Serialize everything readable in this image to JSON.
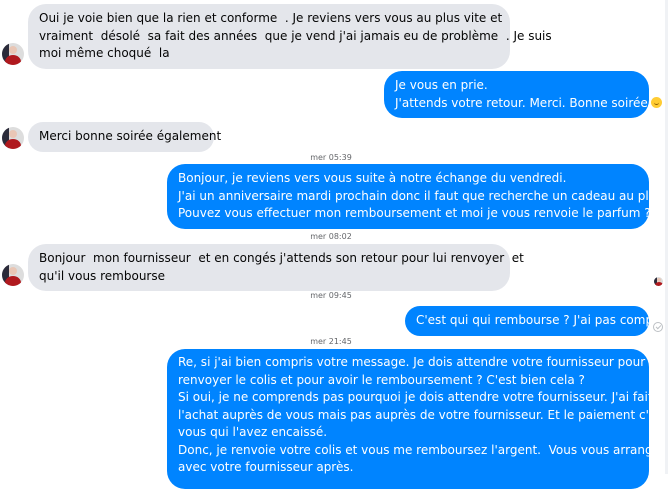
{
  "messages": [
    {
      "dir": "in",
      "lines": [
        "Oui je voie bien que la rien et conforme  . Je reviens vers vous au plus vite et",
        "vraiment  désolé  sa fait des années  que je vend j'ai jamais eu de problème  . Je suis",
        "moi même choqué  la"
      ]
    },
    {
      "dir": "out",
      "lines": [
        "Je vous en prie.",
        "J'attends votre retour. Merci. Bonne soirée"
      ],
      "emoji": "slightly-smiling-face-icon"
    },
    {
      "dir": "in",
      "lines": [
        "Merci bonne soirée également"
      ]
    },
    {
      "timestamp": "mer 05:39"
    },
    {
      "dir": "out",
      "lines": [
        "Bonjour, je reviens vers vous suite à notre échange du vendredi.",
        "J'ai un anniversaire mardi prochain donc il faut que recherche un cadeau au plus vite.",
        "Pouvez vous effectuer mon remboursement et moi je vous renvoie le parfum ? Merci"
      ]
    },
    {
      "timestamp": "mer 08:02"
    },
    {
      "dir": "in",
      "lines": [
        "Bonjour  mon fournisseur  et en congés j'attends son retour pour lui renvoyer  et",
        "qu'il vous rembourse"
      ]
    },
    {
      "timestamp": "mer 09:45"
    },
    {
      "dir": "out",
      "lines": [
        "C'est qui qui rembourse ? J'ai pas compris"
      ]
    },
    {
      "timestamp": "mer 21:45"
    },
    {
      "dir": "out",
      "lines": [
        "Re, si j'ai bien compris votre message. Je dois attendre votre fournisseur pour",
        "renvoyer le colis et pour avoir le remboursement ? C'est bien cela ?",
        "Si oui, je ne comprends pas pourquoi je dois attendre votre fournisseur. J'ai fait",
        "l'achat auprès de vous mais pas auprès de votre fournisseur. Et le paiement c'est",
        "vous qui l'avez encaissé.",
        "Donc, je renvoie votre colis et vous me remboursez l'argent.  Vous vous arrangez",
        "avec votre fournisseur après."
      ]
    }
  ]
}
